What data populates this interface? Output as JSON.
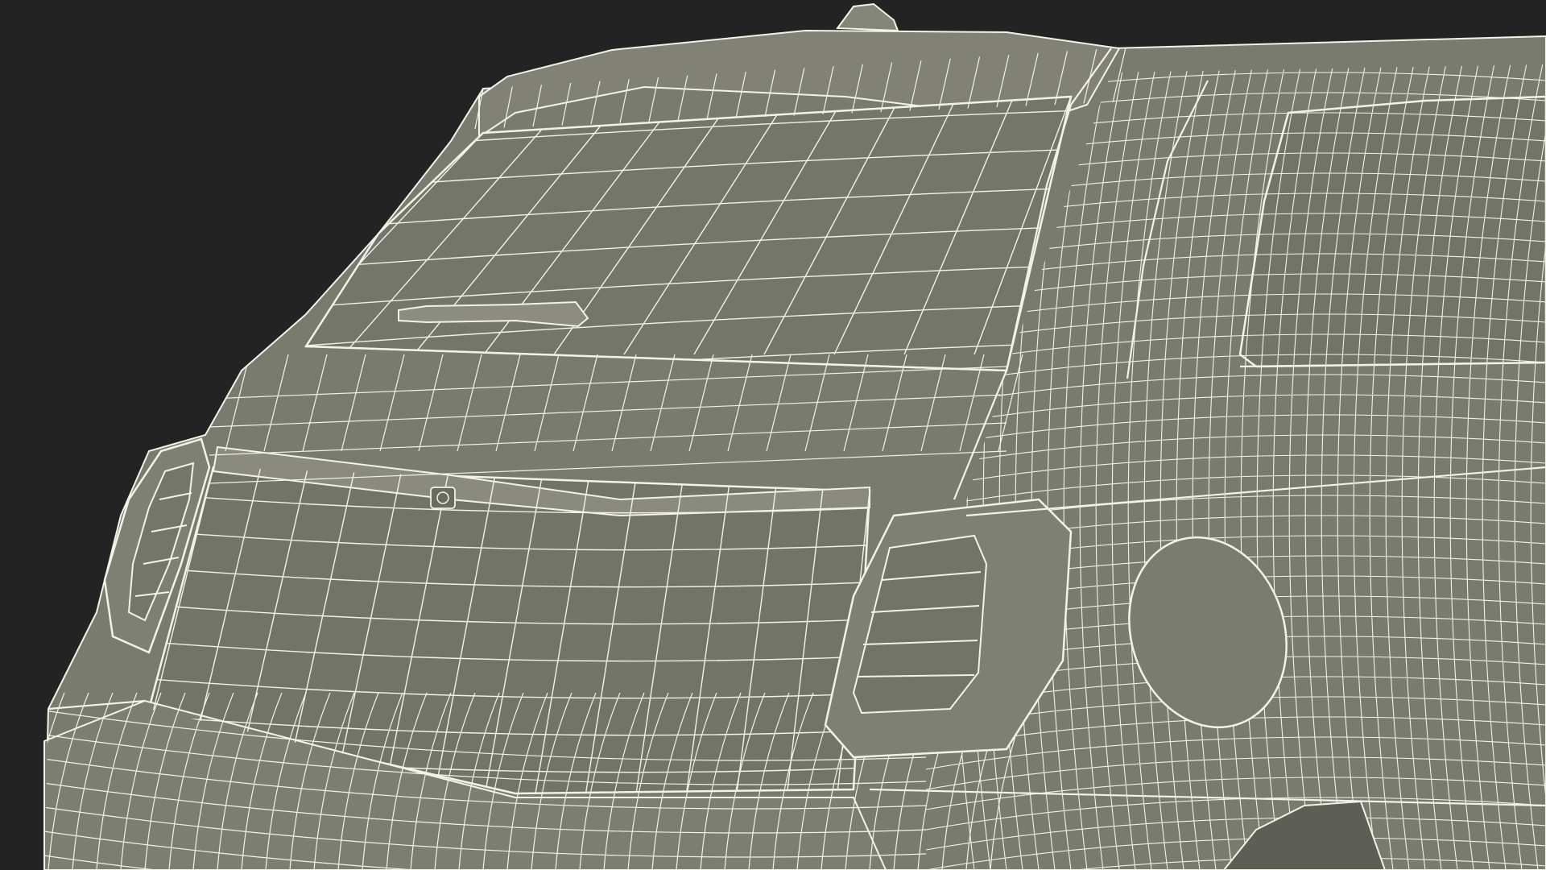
{
  "scene": {
    "subject": "car-rear-wireframe-render",
    "colors": {
      "background": "#232323",
      "body": "#7a7b6f",
      "body_shade": "#6c6d62",
      "body_light": "#86877a",
      "wire": "#f2f2e6"
    }
  }
}
